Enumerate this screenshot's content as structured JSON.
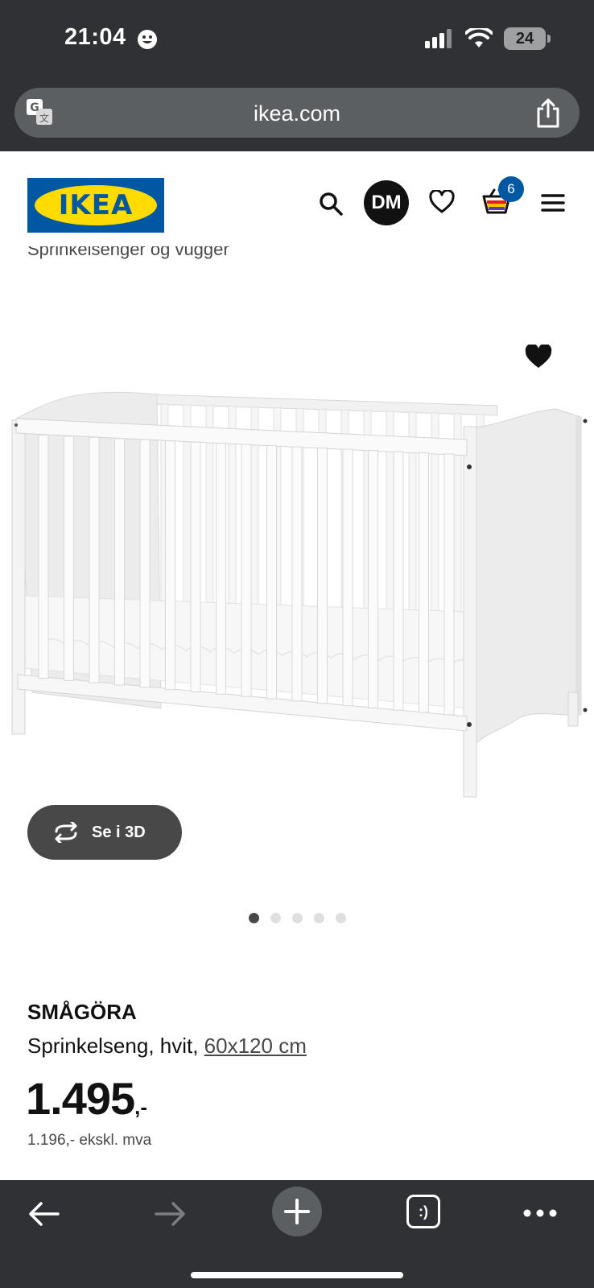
{
  "status_bar": {
    "time": "21:04",
    "battery": "24"
  },
  "browser": {
    "url": "ikea.com"
  },
  "header": {
    "logo": "IKEA",
    "avatar_initials": "DM",
    "cart_count": "6"
  },
  "breadcrumb": "Sprinkelsenger og vugger",
  "product": {
    "view_3d_label": "Se i 3D",
    "name": "SMÅGÖRA",
    "description": "Sprinkelseng, hvit, ",
    "size": "60x120 cm",
    "price": "1.495",
    "price_suffix": ",-",
    "price_ex_vat": "1.196,- ekskl. mva",
    "gallery": {
      "total_images": 5,
      "active_index": 0
    }
  },
  "colors": {
    "chrome": "#2f3134",
    "ikea_blue": "#0058a3",
    "ikea_yellow": "#ffdb00"
  }
}
